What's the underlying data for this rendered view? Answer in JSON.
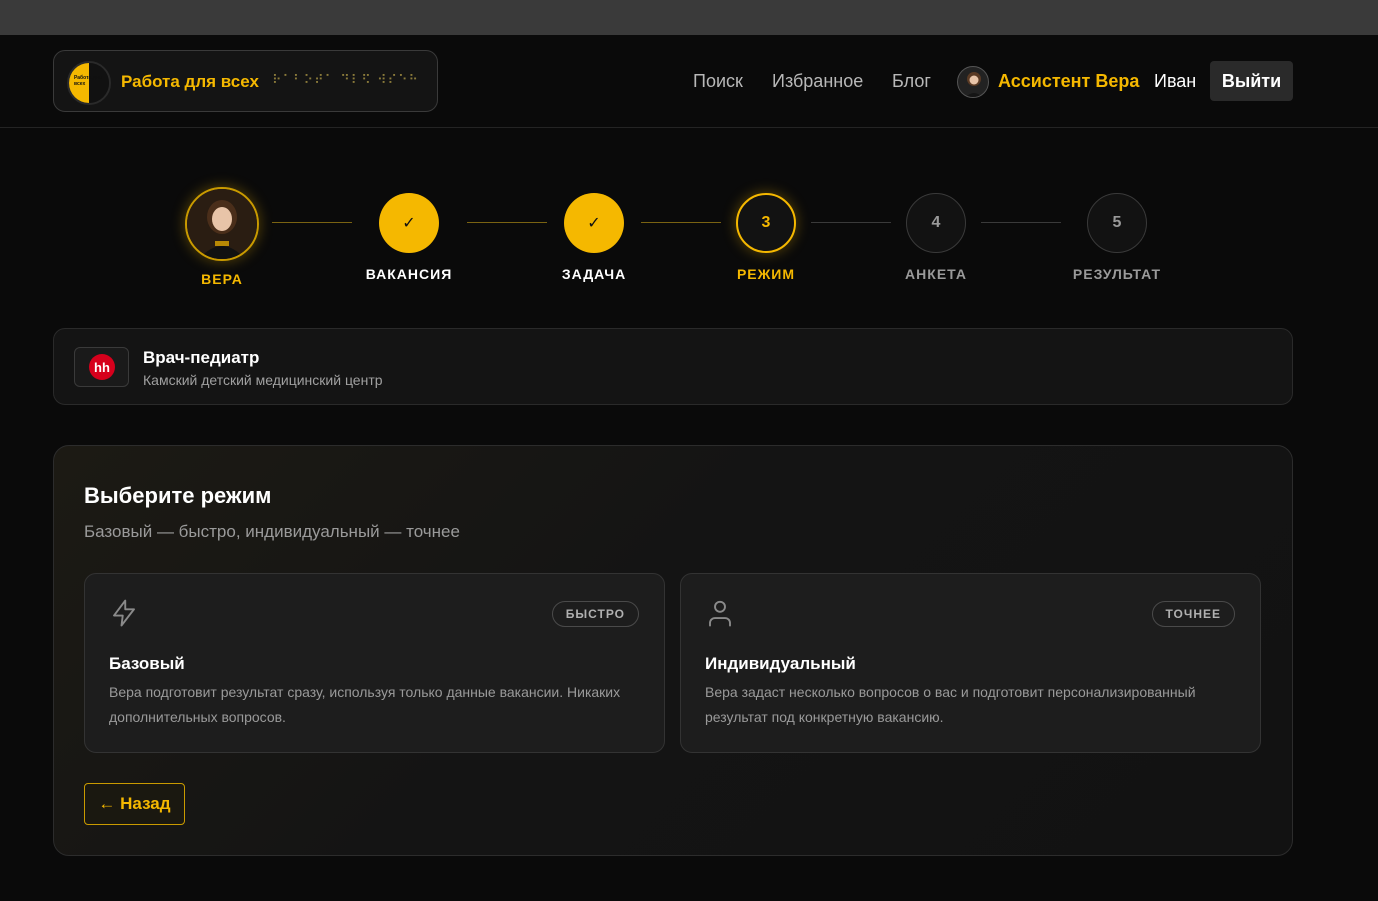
{
  "header": {
    "logo_text": "Работа для всех",
    "logo_mini": "Работа для всех",
    "braille": "⠗⠁⠃⠕⠞⠁ ⠙⠇⠫ ⠺⠎⠑⠓",
    "nav": {
      "search": "Поиск",
      "favorites": "Избранное",
      "blog": "Блог",
      "assistant": "Ассистент Вера",
      "user": "Иван",
      "logout": "Выйти"
    }
  },
  "stepper": [
    {
      "label": "ВЕРА",
      "marker": "",
      "state": "avatar"
    },
    {
      "label": "ВАКАНСИЯ",
      "marker": "✓",
      "state": "done"
    },
    {
      "label": "ЗАДАЧА",
      "marker": "✓",
      "state": "done"
    },
    {
      "label": "РЕЖИМ",
      "marker": "3",
      "state": "active"
    },
    {
      "label": "АНКЕТА",
      "marker": "4",
      "state": "pending"
    },
    {
      "label": "РЕЗУЛЬТАТ",
      "marker": "5",
      "state": "pending"
    }
  ],
  "vacancy": {
    "source_icon": "hh",
    "title": "Врач-педиатр",
    "company": "Камский детский медицинский центр"
  },
  "mode_panel": {
    "title": "Выберите режим",
    "subtitle": "Базовый — быстро, индивидуальный — точнее",
    "modes": [
      {
        "icon": "lightning-icon",
        "badge": "БЫСТРО",
        "title": "Базовый",
        "description": "Вера подготовит результат сразу, используя только данные вакансии. Никаких дополнительных вопросов."
      },
      {
        "icon": "person-icon",
        "badge": "ТОЧНЕЕ",
        "title": "Индивидуальный",
        "description": "Вера задаст несколько вопросов о вас и подготовит персонализированный результат под конкретную вакансию."
      }
    ],
    "back_label": "← Назад"
  },
  "colors": {
    "accent": "#f5b800",
    "background": "#0a0a0a",
    "card": "#1d1d1d"
  }
}
